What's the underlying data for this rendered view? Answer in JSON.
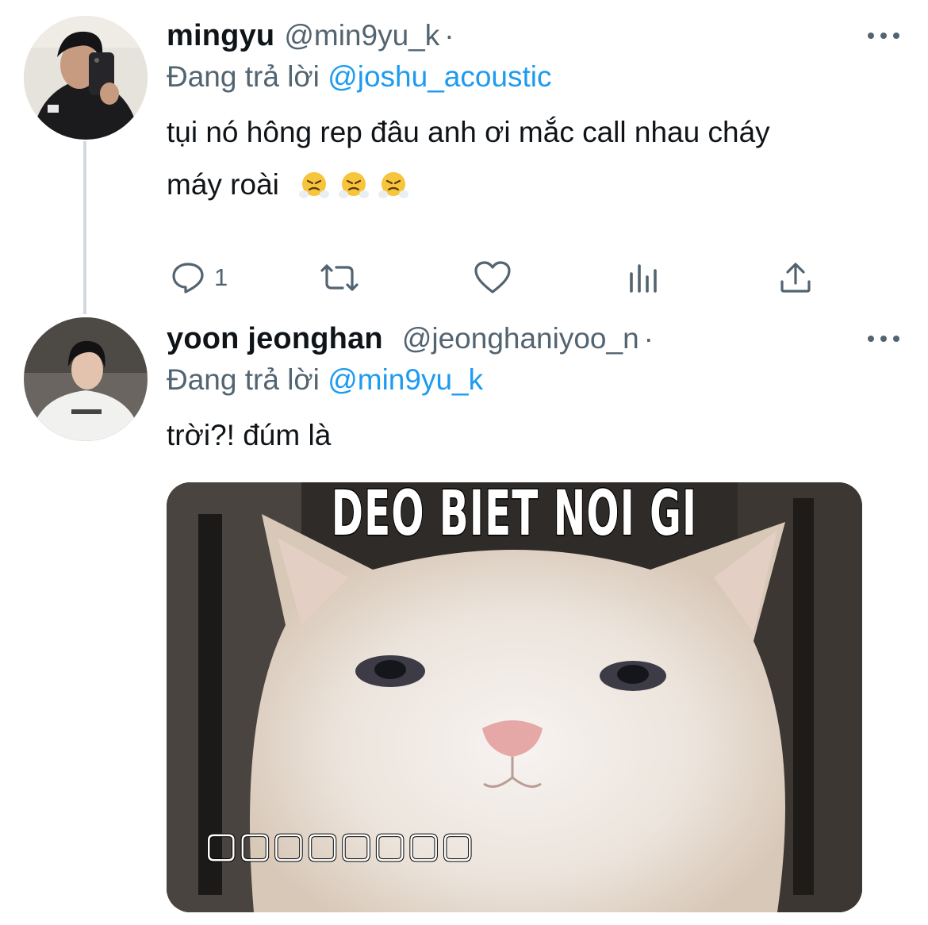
{
  "tweets": [
    {
      "display_name": "mingyu",
      "handle": "@min9yu_k",
      "separator": "·",
      "reply_prefix": "Đang trả lời",
      "reply_to": "@joshu_acoustic",
      "text_line1": "tụi nó hông rep đâu anh ơi mắc call nhau cháy",
      "text_line2": "máy roài",
      "emojis": [
        "face-with-steam-from-nose",
        "face-with-steam-from-nose",
        "face-with-steam-from-nose"
      ],
      "actions": {
        "reply_count": "1"
      }
    },
    {
      "display_name": "yoon jeonghan",
      "handle": "@jeonghaniyoo_n",
      "separator": "·",
      "reply_prefix": "Đang trả lời",
      "reply_to": "@min9yu_k",
      "text": "trời?! đúm là",
      "media": {
        "title": "DEO BIET NOI GI",
        "caption": "▢▢▢▢▢▢▢▢"
      }
    }
  ],
  "icons": {
    "reply": "speech-bubble-icon",
    "retweet": "retweet-icon",
    "like": "heart-icon",
    "analytics": "bar-chart-icon",
    "share": "share-upload-icon",
    "more": "more-dots-icon"
  },
  "colors": {
    "link": "#1d9bf0",
    "secondary_text": "#536471",
    "primary_text": "#0f1419",
    "thread_line": "#cfd9de"
  }
}
